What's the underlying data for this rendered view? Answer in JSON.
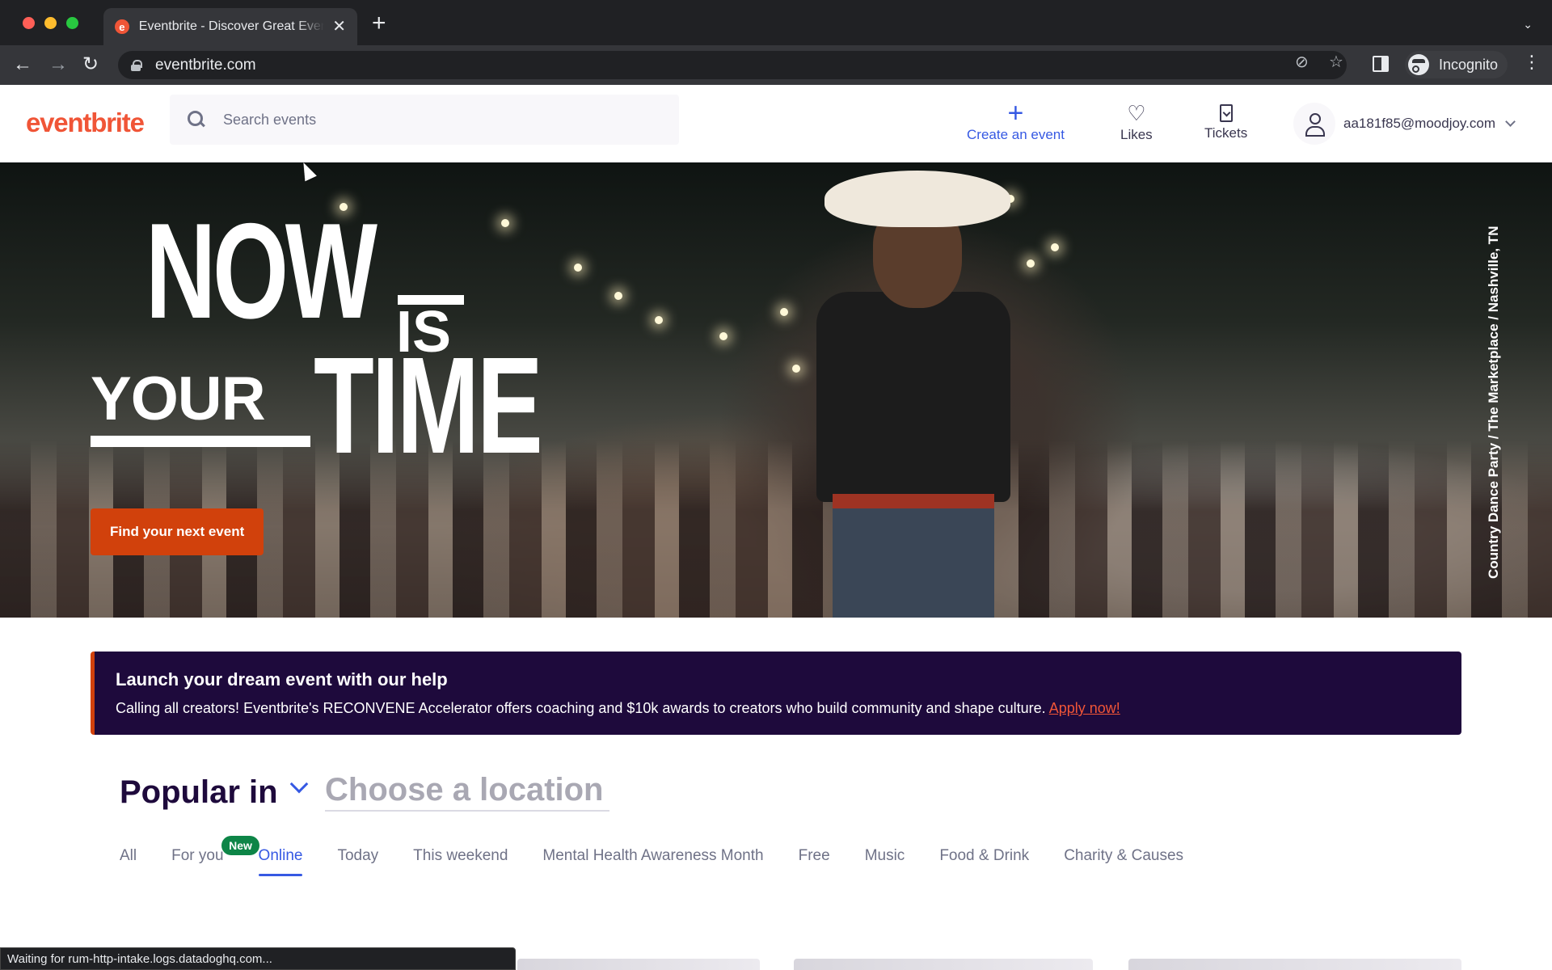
{
  "browser": {
    "tab_title": "Eventbrite - Discover Great Events",
    "url": "eventbrite.com",
    "profile_label": "Incognito",
    "status_text": "Waiting for rum-http-intake.logs.datadoghq.com..."
  },
  "header": {
    "logo": "eventbrite",
    "search_placeholder": "Search events",
    "create_label": "Create an event",
    "likes_label": "Likes",
    "tickets_label": "Tickets",
    "user_email": "aa181f85@moodjoy.com"
  },
  "hero": {
    "line_now": "NOW",
    "line_is": "IS",
    "line_your": "YOUR",
    "line_time": "TIME",
    "cta_label": "Find your next event",
    "photo_caption": "Country Dance Party / The Marketplace / Nashville, TN"
  },
  "banner": {
    "title": "Launch your dream event with our help",
    "body": "Calling all creators! Eventbrite's RECONVENE Accelerator offers coaching and $10k awards to creators who build community and shape culture.",
    "link_label": "Apply now!"
  },
  "popular": {
    "label": "Popular in",
    "location_placeholder": "Choose a location",
    "new_badge": "New",
    "tabs": [
      "All",
      "For you",
      "Online",
      "Today",
      "This weekend",
      "Mental Health Awareness Month",
      "Free",
      "Music",
      "Food & Drink",
      "Charity & Causes"
    ],
    "active_tab": "Online"
  },
  "colors": {
    "brand_orange": "#f05537",
    "cta_orange": "#d1410c",
    "accent_blue": "#3659e3",
    "banner_bg": "#1e0a3c",
    "new_green": "#0d8547"
  },
  "icons": [
    "search-icon",
    "plus-icon",
    "heart-icon",
    "ticket-icon",
    "user-icon",
    "chevron-down-icon",
    "lock-icon",
    "star-icon",
    "eye-off-icon"
  ]
}
